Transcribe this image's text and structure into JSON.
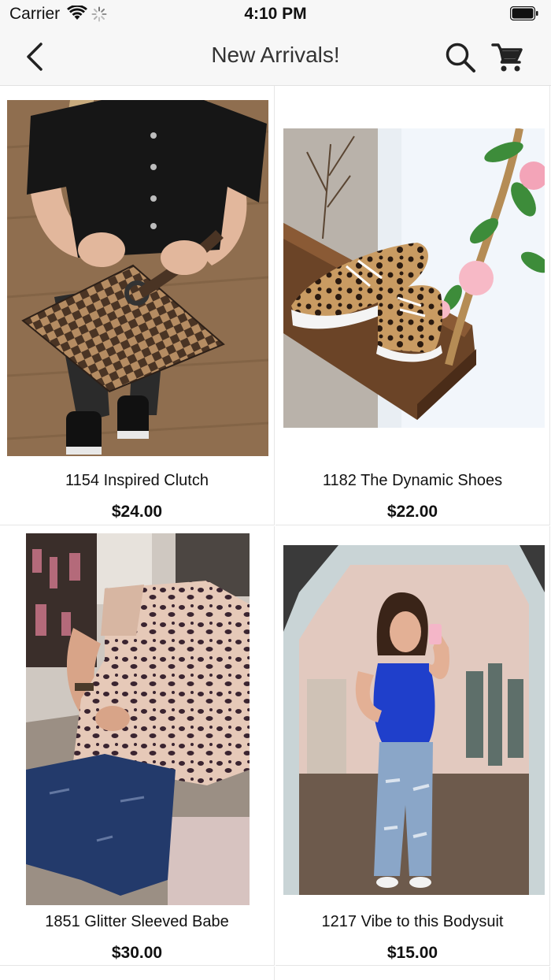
{
  "status_bar": {
    "carrier": "Carrier",
    "time": "4:10 PM"
  },
  "nav": {
    "title": "New Arrivals!"
  },
  "icons": {
    "back": "chevron-left-icon",
    "search": "search-icon",
    "cart": "cart-icon"
  },
  "products": [
    {
      "name": "1154 Inspired Clutch",
      "price": "$24.00"
    },
    {
      "name": "1182 The Dynamic Shoes",
      "price": "$22.00"
    },
    {
      "name": "1851 Glitter Sleeved Babe",
      "price": "$30.00"
    },
    {
      "name": "1217 Vibe to this Bodysuit",
      "price": "$15.00"
    }
  ],
  "colors": {
    "bar_background": "#f7f7f7",
    "text": "#111111",
    "divider": "#e6e6e6"
  }
}
